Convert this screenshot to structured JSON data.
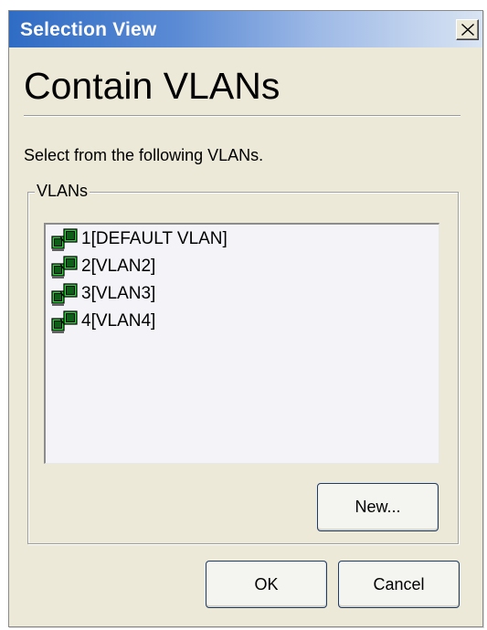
{
  "window": {
    "title": "Selection View",
    "close_label": "close"
  },
  "page": {
    "heading": "Contain VLANs",
    "instruction": "Select from the following VLANs."
  },
  "vlans_group": {
    "legend": "VLANs",
    "items": [
      {
        "label": "1[DEFAULT VLAN]",
        "icon": "vlan-icon"
      },
      {
        "label": "2[VLAN2]",
        "icon": "vlan-icon"
      },
      {
        "label": "3[VLAN3]",
        "icon": "vlan-icon"
      },
      {
        "label": "4[VLAN4]",
        "icon": "vlan-icon"
      }
    ],
    "new_button": "New..."
  },
  "footer": {
    "ok_button": "OK",
    "cancel_button": "Cancel"
  },
  "colors": {
    "titlebar_start": "#2f6cc4",
    "dialog_background": "#ece9d8",
    "icon_green": "#2fd13a",
    "button_border": "#1d3b6b"
  }
}
